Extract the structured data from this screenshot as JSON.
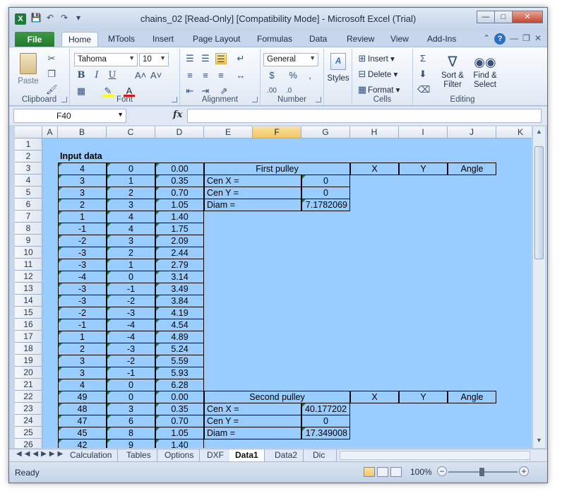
{
  "window": {
    "title": "chains_02  [Read-Only]  [Compatibility Mode]  -  Microsoft Excel (Trial)"
  },
  "ribbon_tabs": [
    "File",
    "Home",
    "MTools",
    "Insert",
    "Page Layout",
    "Formulas",
    "Data",
    "Review",
    "View",
    "Add-Ins"
  ],
  "ribbon": {
    "clipboard": {
      "label": "Clipboard",
      "paste": "Paste"
    },
    "font": {
      "label": "Font",
      "name": "Tahoma",
      "size": "10"
    },
    "alignment": {
      "label": "Alignment"
    },
    "number": {
      "label": "Number",
      "format": "General"
    },
    "styles": {
      "label": "Styles"
    },
    "cells": {
      "label": "Cells",
      "insert": "Insert",
      "delete": "Delete",
      "format": "Format"
    },
    "editing": {
      "label": "Editing",
      "sort": "Sort &",
      "filter": "Filter",
      "find": "Find &",
      "select": "Select"
    }
  },
  "formula_bar": {
    "name_box": "F40",
    "fx": "fx",
    "formula": ""
  },
  "columns": [
    "A",
    "B",
    "C",
    "D",
    "E",
    "F",
    "G",
    "H",
    "I",
    "J",
    "K"
  ],
  "selected_column": "F",
  "rows": [
    1,
    2,
    3,
    4,
    5,
    6,
    7,
    8,
    9,
    10,
    11,
    12,
    13,
    14,
    15,
    16,
    17,
    18,
    19,
    20,
    21,
    22,
    23,
    24,
    25,
    26
  ],
  "sheet": {
    "title_cell": "Input data",
    "bcd": [
      [
        "4",
        "0",
        "0.00"
      ],
      [
        "3",
        "1",
        "0.35"
      ],
      [
        "3",
        "2",
        "0.70"
      ],
      [
        "2",
        "3",
        "1.05"
      ],
      [
        "1",
        "4",
        "1.40"
      ],
      [
        "-1",
        "4",
        "1.75"
      ],
      [
        "-2",
        "3",
        "2.09"
      ],
      [
        "-3",
        "2",
        "2.44"
      ],
      [
        "-3",
        "1",
        "2.79"
      ],
      [
        "-4",
        "0",
        "3.14"
      ],
      [
        "-3",
        "-1",
        "3.49"
      ],
      [
        "-3",
        "-2",
        "3.84"
      ],
      [
        "-2",
        "-3",
        "4.19"
      ],
      [
        "-1",
        "-4",
        "4.54"
      ],
      [
        "1",
        "-4",
        "4.89"
      ],
      [
        "2",
        "-3",
        "5.24"
      ],
      [
        "3",
        "-2",
        "5.59"
      ],
      [
        "3",
        "-1",
        "5.93"
      ],
      [
        "4",
        "0",
        "6.28"
      ],
      [
        "49",
        "0",
        "0.00"
      ],
      [
        "48",
        "3",
        "0.35"
      ],
      [
        "47",
        "6",
        "0.70"
      ],
      [
        "45",
        "8",
        "1.05"
      ],
      [
        "42",
        "9",
        "1.40"
      ]
    ],
    "first_pulley": {
      "header": "First pulley",
      "x": "X",
      "y": "Y",
      "angle": "Angle",
      "cen_x_label": "Cen X =",
      "cen_x": "0",
      "cen_y_label": "Cen Y =",
      "cen_y": "0",
      "diam_label": "Diam =",
      "diam": "7.1782069"
    },
    "second_pulley": {
      "header": "Second pulley",
      "x": "X",
      "y": "Y",
      "angle": "Angle",
      "cen_x_label": "Cen X =",
      "cen_x": "40.177202",
      "cen_y_label": "Cen Y =",
      "cen_y": "0",
      "diam_label": "Diam =",
      "diam": "17.349008"
    }
  },
  "sheet_tabs": [
    "Calculation",
    "Tables",
    "Options",
    "DXF",
    "Data1",
    "Data2",
    "Dic"
  ],
  "active_sheet": "Data1",
  "status": {
    "ready": "Ready",
    "zoom": "100%"
  }
}
